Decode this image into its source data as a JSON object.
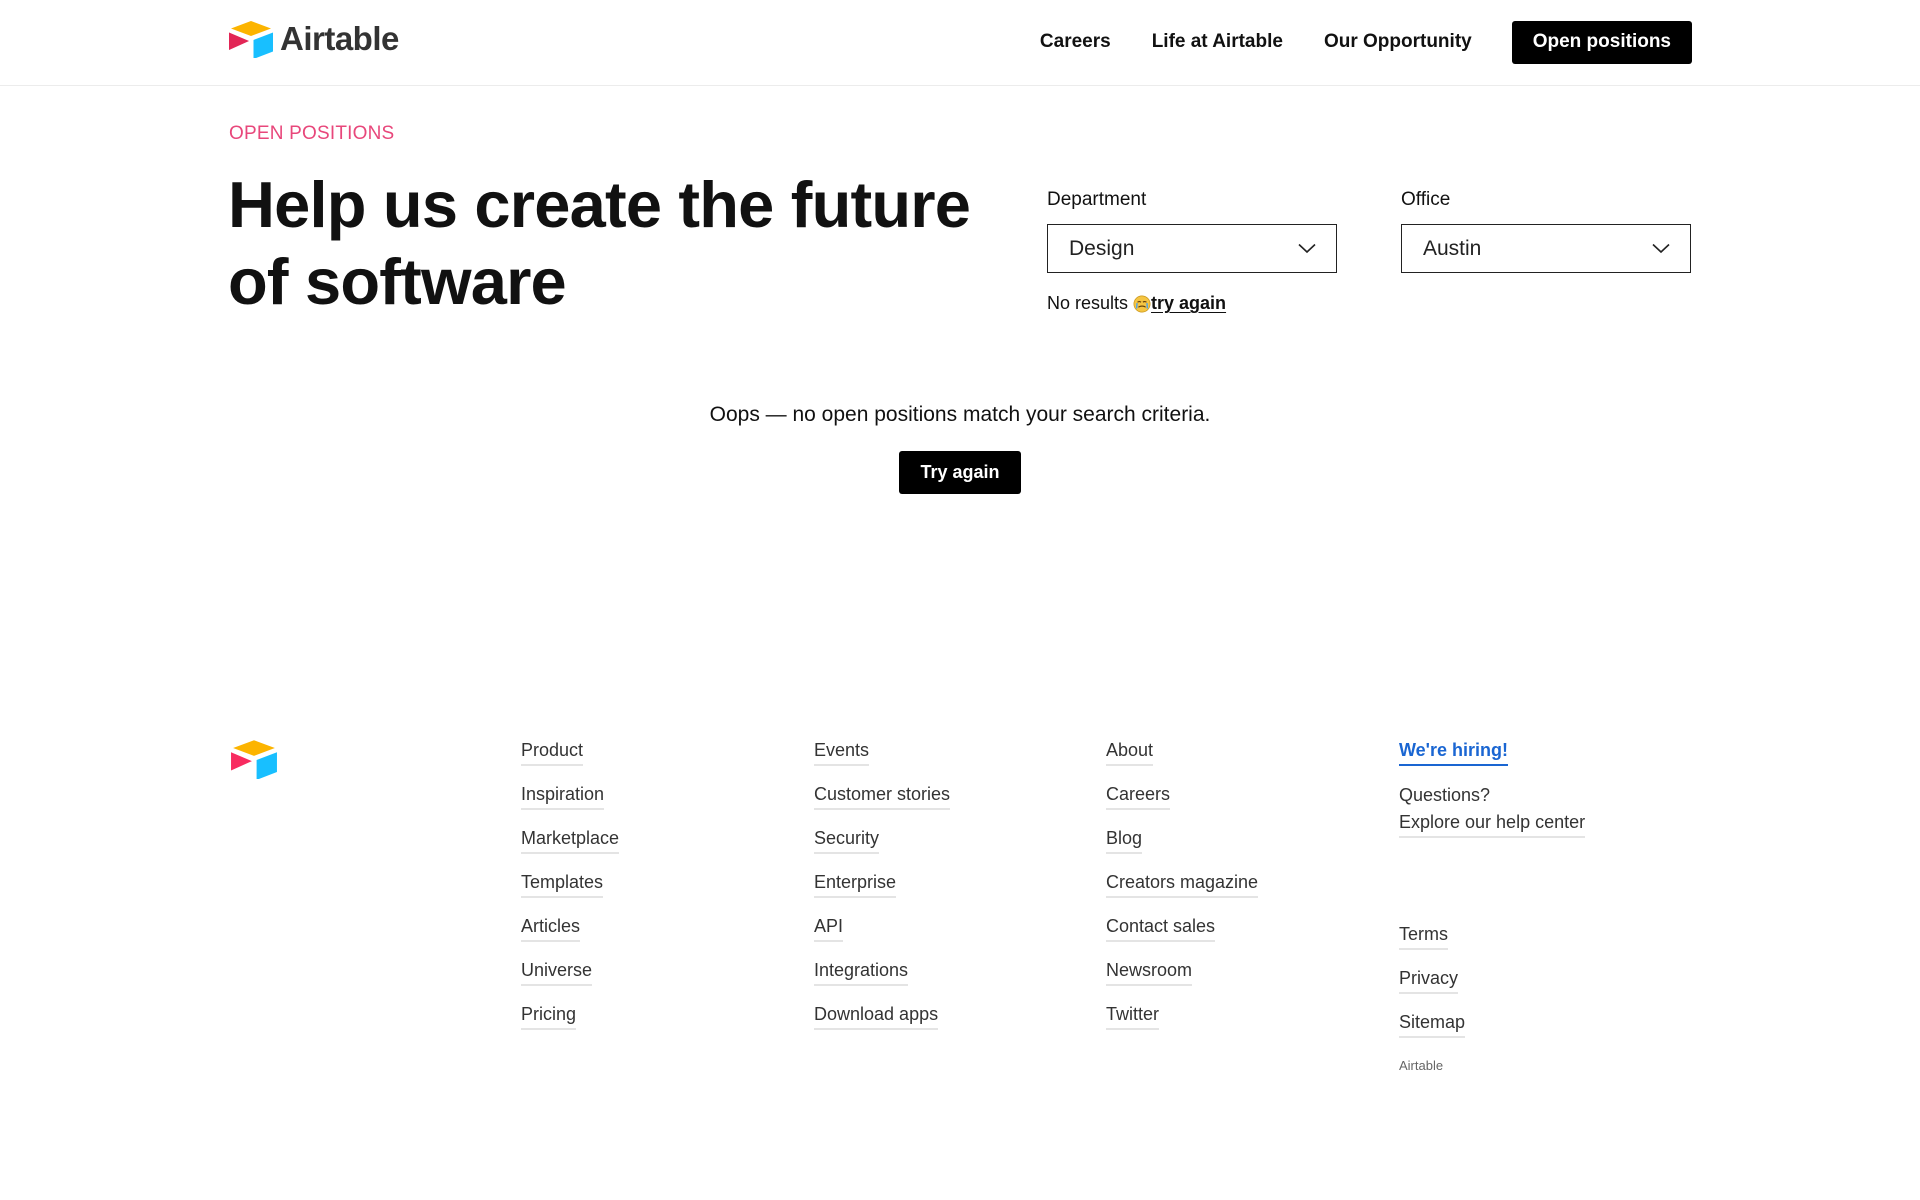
{
  "header": {
    "brand": "Airtable",
    "nav": [
      {
        "label": "Careers"
      },
      {
        "label": "Life at Airtable"
      },
      {
        "label": "Our Opportunity"
      }
    ],
    "cta_label": "Open positions"
  },
  "hero": {
    "eyebrow": "OPEN POSITIONS",
    "headline": "Help us create the future of software",
    "eyebrow_color": "#e8477b"
  },
  "filters": {
    "department": {
      "label": "Department",
      "value": "Design"
    },
    "office": {
      "label": "Office",
      "value": "Austin"
    },
    "no_results_text": "No results",
    "no_results_emoji": "crying-face-icon",
    "try_again_link": "try again"
  },
  "empty_state": {
    "message": "Oops — no open positions match your search criteria.",
    "button_label": "Try again"
  },
  "footer": {
    "columns": [
      [
        "Product",
        "Inspiration",
        "Marketplace",
        "Templates",
        "Articles",
        "Universe",
        "Pricing"
      ],
      [
        "Events",
        "Customer stories",
        "Security",
        "Enterprise",
        "API",
        "Integrations",
        "Download apps"
      ],
      [
        "About",
        "Careers",
        "Blog",
        "Creators magazine",
        "Contact sales",
        "Newsroom",
        "Twitter"
      ]
    ],
    "hiring_label": "We're hiring!",
    "questions_label": "Questions?",
    "help_center_label": "Explore our help center",
    "legal_links": [
      "Terms",
      "Privacy",
      "Sitemap"
    ],
    "copyright": "Airtable",
    "accent_color": "#1a66d2"
  }
}
